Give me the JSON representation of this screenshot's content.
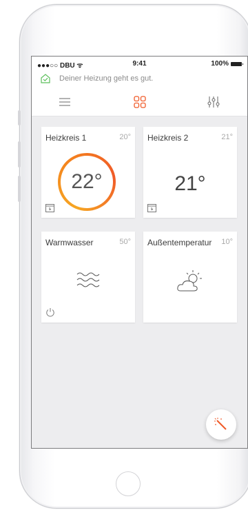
{
  "status_bar": {
    "carrier": "●●●○○ DBU ᯤ",
    "time": "9:41",
    "battery": "100%"
  },
  "message": {
    "icon": "house-check-icon",
    "text": "Deiner Heizung geht es gut."
  },
  "tabs": [
    {
      "icon": "list-icon",
      "active": false
    },
    {
      "icon": "grid-icon",
      "active": true
    },
    {
      "icon": "sliders-icon",
      "active": false
    }
  ],
  "cards": [
    {
      "title": "Heizkreis 1",
      "temp": "20°",
      "value": "22°",
      "icon": "calendar-icon"
    },
    {
      "title": "Heizkreis 2",
      "temp": "21°",
      "value": "21°",
      "icon": "calendar-icon"
    },
    {
      "title": "Warmwasser",
      "temp": "50°",
      "icon": "water-waves-icon",
      "sub_icon": "power-icon"
    },
    {
      "title": "Außentemperatur",
      "temp": "10°",
      "icon": "cloud-sun-icon"
    }
  ],
  "fab": {
    "icon": "magic-wand-icon"
  },
  "colors": {
    "accent": "#f05a28",
    "ring_start": "#f6a623",
    "check": "#5bbf5b"
  }
}
